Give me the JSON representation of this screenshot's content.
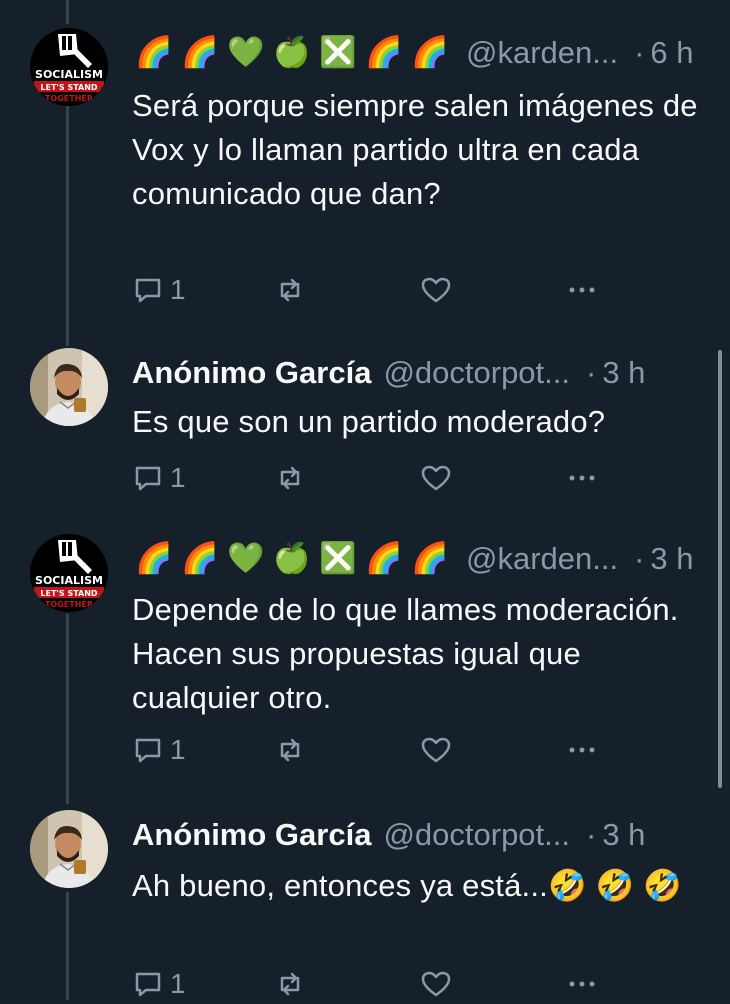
{
  "tweets": [
    {
      "name": "",
      "emoji_name": [
        "🌈",
        "🌈",
        "💚",
        "🍏",
        "❎",
        "🌈",
        "🌈"
      ],
      "handle": "@karden...",
      "time": "6 h",
      "text": "Será porque siempre salen imágenes de Vox y lo llaman partido ultra en cada comunicado que dan?",
      "reply_count": "1",
      "avatar_icon": "socialism-logo-avatar",
      "avatar_text": [
        "SOCIALISM",
        "LET'S STAND",
        "TOGETHER"
      ]
    },
    {
      "name": "Anónimo García",
      "handle": "@doctorpot...",
      "time": "3 h",
      "text": "Es que son un partido moderado?",
      "reply_count": "1",
      "avatar_icon": "person-photo-avatar"
    },
    {
      "name": "",
      "emoji_name": [
        "🌈",
        "🌈",
        "💚",
        "🍏",
        "❎",
        "🌈",
        "🌈"
      ],
      "handle": "@karden...",
      "time": "3 h",
      "text": "Depende de lo que llames moderación. Hacen sus propuestas igual que cualquier otro.",
      "reply_count": "1",
      "avatar_icon": "socialism-logo-avatar",
      "avatar_text": [
        "SOCIALISM",
        "LET'S STAND",
        "TOGETHER"
      ]
    },
    {
      "name": "Anónimo García",
      "handle": "@doctorpot...",
      "time": "3 h",
      "text": "Ah bueno, entonces ya está...🤣 🤣 🤣",
      "reply_count": "1",
      "avatar_icon": "person-photo-avatar"
    }
  ],
  "separator": "·",
  "colors": {
    "background": "#15202b",
    "text": "#f7f9f9",
    "secondary": "#8b98a5",
    "thread_line": "#38444d"
  }
}
